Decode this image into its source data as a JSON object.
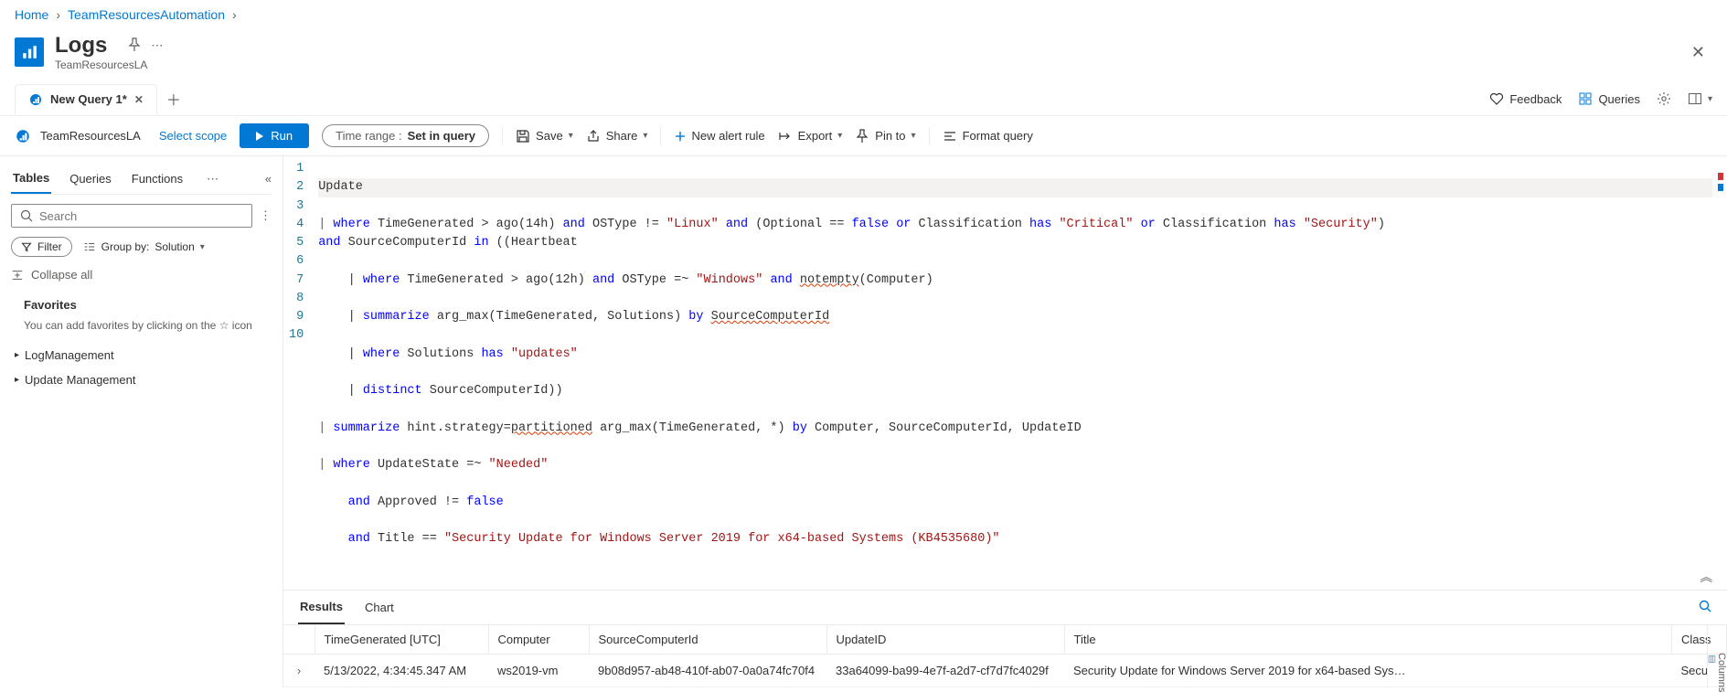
{
  "breadcrumb": {
    "home": "Home",
    "item1": "TeamResourcesAutomation"
  },
  "header": {
    "title": "Logs",
    "subtitle": "TeamResourcesLA"
  },
  "tab": {
    "label": "New Query 1*"
  },
  "topRight": {
    "feedback": "Feedback",
    "queries": "Queries"
  },
  "scope": {
    "workspace": "TeamResourcesLA",
    "select": "Select scope"
  },
  "toolbar": {
    "run": "Run",
    "timerange_label": "Time range :",
    "timerange_value": "Set in query",
    "save": "Save",
    "share": "Share",
    "newalert": "New alert rule",
    "export": "Export",
    "pinto": "Pin to",
    "format": "Format query"
  },
  "side": {
    "tabs": {
      "tables": "Tables",
      "queries": "Queries",
      "functions": "Functions"
    },
    "search_placeholder": "Search",
    "filter": "Filter",
    "groupby_label": "Group by:",
    "groupby_value": "Solution",
    "collapse": "Collapse all",
    "favorites": "Favorites",
    "fav_hint": "You can add favorites by clicking on the ☆ icon",
    "tree": {
      "log": "LogManagement",
      "update": "Update Management"
    }
  },
  "editor": {
    "lines": [
      "1",
      "2",
      "3",
      "4",
      "5",
      "6",
      "7",
      "8",
      "9",
      "10"
    ],
    "l1": "Update",
    "l2a": "| ",
    "l2_where": "where",
    "l2b": " TimeGenerated > ago(14h) ",
    "l2_and": "and",
    "l2c": " OSType != ",
    "l2_linux": "\"Linux\"",
    "l2d": " ",
    "l2_and2": "and",
    "l2e": " (Optional == ",
    "l2_false": "false",
    "l2f": " ",
    "l2_or": "or",
    "l2g": " Classification ",
    "l2_has": "has",
    "l2h": " ",
    "l2_crit": "\"Critical\"",
    "l2i": " ",
    "l2_or2": "or",
    "l2j": " Classification ",
    "l2_has2": "has",
    "l2k": " ",
    "l2_sec": "\"Security\"",
    "l2l": ")",
    "l2_5a": "and",
    "l2_5b": " SourceComputerId ",
    "l2_5_in": "in",
    "l2_5c": " ((Heartbeat",
    "l3a": "    | ",
    "l3_where": "where",
    "l3b": " TimeGenerated > ago(12h) ",
    "l3_and": "and",
    "l3c": " OSType =~ ",
    "l3_win": "\"Windows\"",
    "l3d": " ",
    "l3_and2": "and",
    "l3e": " ",
    "l3_ne": "notempty",
    "l3f": "(Computer)",
    "l4a": "    | ",
    "l4_sum": "summarize",
    "l4b": " arg_max(TimeGenerated, Solutions) ",
    "l4_by": "by",
    "l4c": " ",
    "l4_sq": "SourceComputerId",
    "l5a": "    | ",
    "l5_where": "where",
    "l5b": " Solutions ",
    "l5_has": "has",
    "l5c": " ",
    "l5_upd": "\"updates\"",
    "l6a": "    | ",
    "l6_dist": "distinct",
    "l6b": " SourceComputerId))",
    "l7a": "| ",
    "l7_sum": "summarize",
    "l7b": " hint.strategy=",
    "l7_part": "partitioned",
    "l7c": " arg_max(TimeGenerated, *) ",
    "l7_by": "by",
    "l7d": " Computer, SourceComputerId, UpdateID",
    "l8a": "| ",
    "l8_where": "where",
    "l8b": " UpdateState =~ ",
    "l8_need": "\"Needed\"",
    "l9a": "    ",
    "l9_and": "and",
    "l9b": " Approved != ",
    "l9_false": "false",
    "l10a": "    ",
    "l10_and": "and",
    "l10b": " Title == ",
    "l10_str": "\"Security Update for Windows Server 2019 for x64-based Systems (KB4535680)\""
  },
  "results": {
    "tabs": {
      "results": "Results",
      "chart": "Chart"
    },
    "columns_label": "Columns",
    "headers": {
      "time": "TimeGenerated [UTC]",
      "computer": "Computer",
      "source": "SourceComputerId",
      "update": "UpdateID",
      "title": "Title",
      "class": "Class"
    },
    "rows": [
      {
        "time": "5/13/2022, 4:34:45.347 AM",
        "computer": "ws2019-vm",
        "source": "9b08d957-ab48-410f-ab07-0a0a74fc70f4",
        "update": "33a64099-ba99-4e7f-a2d7-cf7d7fc4029f",
        "title": "Security Update for Windows Server 2019 for x64-based Sys…",
        "class": "Secu"
      }
    ]
  }
}
